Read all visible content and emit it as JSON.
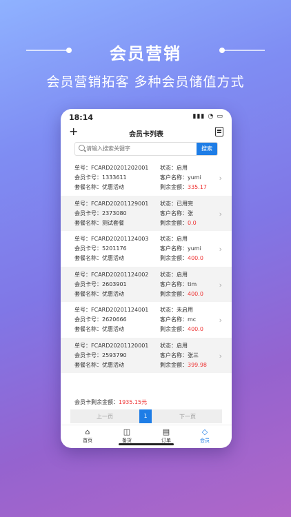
{
  "hero": {
    "title": "会员营销",
    "subtitle": "会员营销拓客 多种会员储值方式"
  },
  "status": {
    "time": "18:14",
    "icons": "▮▮▮ ◔ ▭"
  },
  "nav": {
    "plus": "+",
    "title": "会员卡列表"
  },
  "search": {
    "placeholder": "请输入搜索关键字",
    "button": "搜索"
  },
  "cards": [
    {
      "no_label": "单号：",
      "no": "FCARD20201202001",
      "card_label": "会员卡号：",
      "card": "1333611",
      "pkg_label": "套餐名称：",
      "pkg": "优惠活动",
      "status_label": "状态：",
      "status": "启用",
      "cust_label": "客户名称：",
      "cust": "yumi",
      "bal_label": "剩余金额：",
      "bal": "335.17"
    },
    {
      "no_label": "单号：",
      "no": "FCARD20201129001",
      "card_label": "会员卡号：",
      "card": "2373080",
      "pkg_label": "套餐名称：",
      "pkg": "测试套餐",
      "status_label": "状态：",
      "status": "已用完",
      "cust_label": "客户名称：",
      "cust": "张",
      "bal_label": "剩余金额：",
      "bal": "0.0"
    },
    {
      "no_label": "单号：",
      "no": "FCARD20201124003",
      "card_label": "会员卡号：",
      "card": "5201176",
      "pkg_label": "套餐名称：",
      "pkg": "优惠活动",
      "status_label": "状态：",
      "status": "启用",
      "cust_label": "客户名称：",
      "cust": "yumi",
      "bal_label": "剩余金额：",
      "bal": "400.0"
    },
    {
      "no_label": "单号：",
      "no": "FCARD20201124002",
      "card_label": "会员卡号：",
      "card": "2603901",
      "pkg_label": "套餐名称：",
      "pkg": "优惠活动",
      "status_label": "状态：",
      "status": "启用",
      "cust_label": "客户名称：",
      "cust": "tim",
      "bal_label": "剩余金额：",
      "bal": "400.0"
    },
    {
      "no_label": "单号：",
      "no": "FCARD20201124001",
      "card_label": "会员卡号：",
      "card": "2620666",
      "pkg_label": "套餐名称：",
      "pkg": "优惠活动",
      "status_label": "状态：",
      "status": "未启用",
      "cust_label": "客户名称：",
      "cust": "mc",
      "bal_label": "剩余金额：",
      "bal": "400.0"
    },
    {
      "no_label": "单号：",
      "no": "FCARD20201120001",
      "card_label": "会员卡号：",
      "card": "2593790",
      "pkg_label": "套餐名称：",
      "pkg": "优惠活动",
      "status_label": "状态：",
      "status": "启用",
      "cust_label": "客户名称：",
      "cust": "张三",
      "bal_label": "剩余金额：",
      "bal": "399.98"
    }
  ],
  "summary": {
    "label": "会员卡剩余金额：",
    "value": "1935.15元"
  },
  "pager": {
    "prev": "上一页",
    "current": "1",
    "next": "下一页"
  },
  "tabs": [
    {
      "icon": "⌂",
      "label": "首页"
    },
    {
      "icon": "◫",
      "label": "备货"
    },
    {
      "icon": "▤",
      "label": "订单"
    },
    {
      "icon": "◇",
      "label": "会员"
    }
  ],
  "colors": {
    "accent": "#1e7de6",
    "balance": "#e33333"
  }
}
